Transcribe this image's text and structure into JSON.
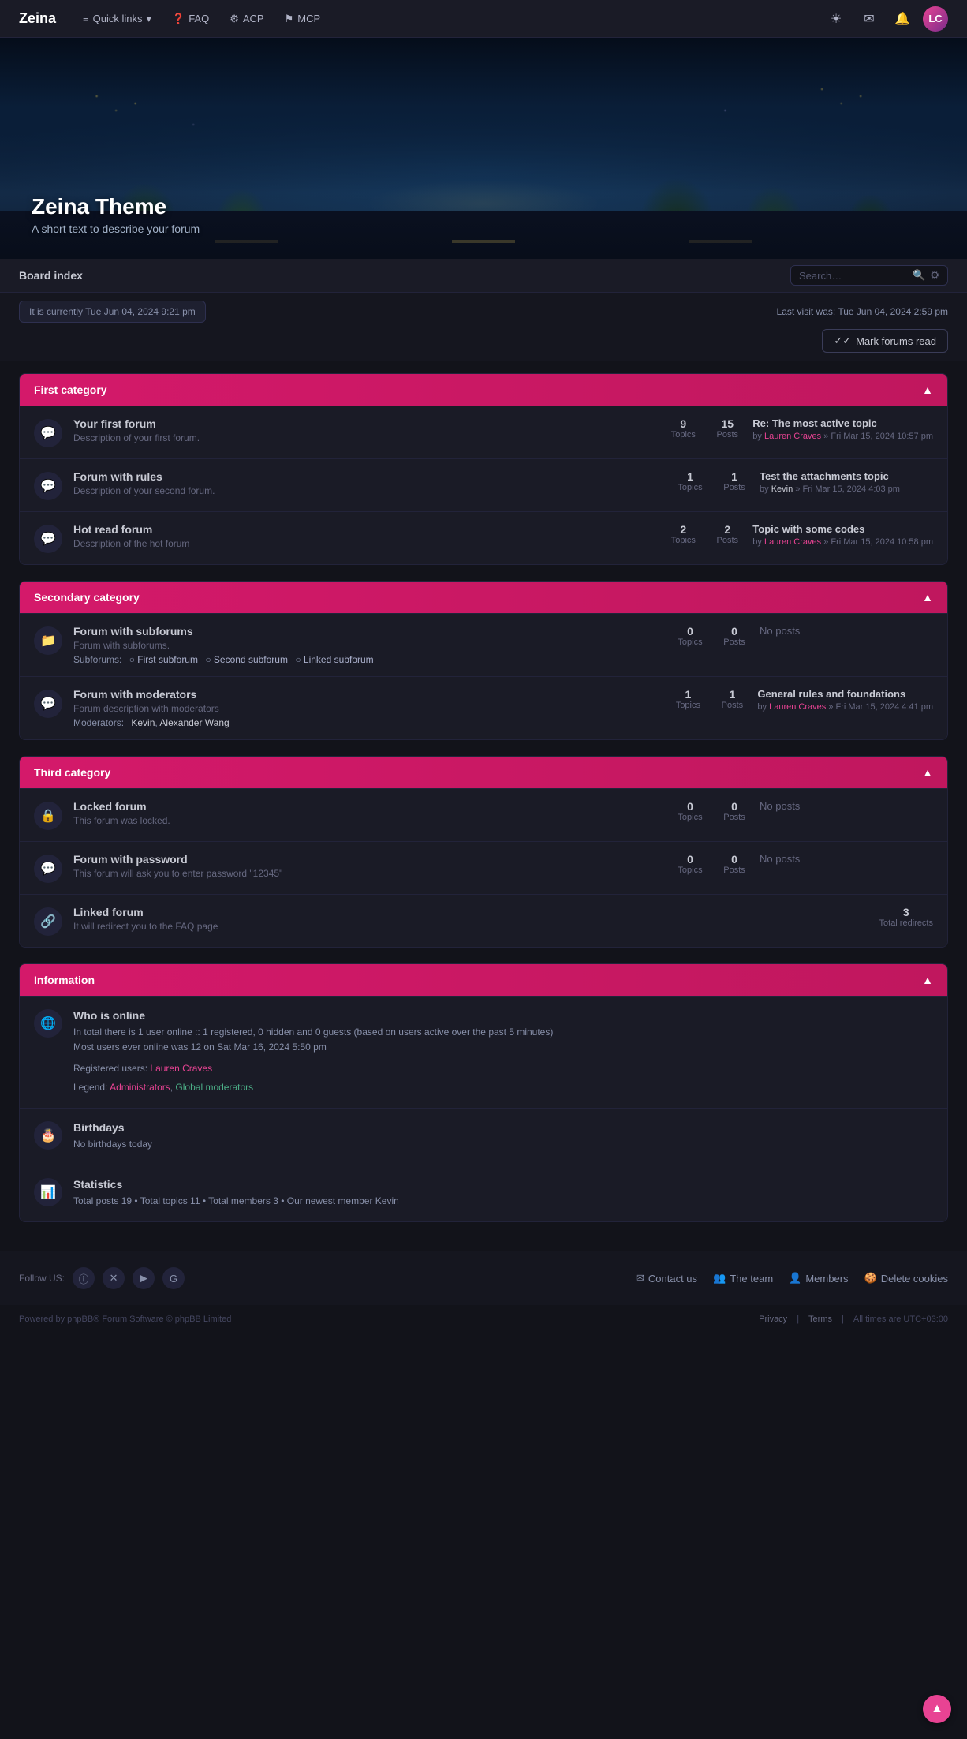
{
  "navbar": {
    "brand": "Zeina",
    "links": [
      {
        "label": "Quick links",
        "icon": "≡",
        "has_arrow": true
      },
      {
        "label": "FAQ",
        "icon": "?"
      },
      {
        "label": "ACP",
        "icon": "⚙"
      },
      {
        "label": "MCP",
        "icon": "⚑"
      }
    ],
    "icons": [
      "☀",
      "✉",
      "🔔"
    ],
    "avatar_initials": "LC"
  },
  "hero": {
    "title": "Zeina Theme",
    "subtitle": "A short text to describe your forum"
  },
  "breadcrumb_bar": {
    "breadcrumb": "Board index",
    "search_placeholder": "Search…"
  },
  "info_bar": {
    "current_time": "It is currently Tue Jun 04, 2024 9:21 pm",
    "last_visit": "Last visit was: Tue Jun 04, 2024 2:59 pm",
    "mark_read_label": "Mark forums read"
  },
  "categories": [
    {
      "id": "first",
      "title": "First category",
      "forums": [
        {
          "name": "Your first forum",
          "desc": "Description of your first forum.",
          "topics": "9",
          "posts": "15",
          "last_post_title": "Re: The most active topic",
          "last_post_by": "Lauren Craves",
          "last_post_date": "» Fri Mar 15, 2024 10:57 pm",
          "icon_type": "chat",
          "subforums": null,
          "moderators": null
        },
        {
          "name": "Forum with rules",
          "desc": "Description of your second forum.",
          "topics": "1",
          "posts": "1",
          "last_post_title": "Test the attachments topic",
          "last_post_by": "Kevin",
          "last_post_date": "» Fri Mar 15, 2024 4:03 pm",
          "icon_type": "chat",
          "subforums": null,
          "moderators": null
        },
        {
          "name": "Hot read forum",
          "desc": "Description of the hot forum",
          "topics": "2",
          "posts": "2",
          "last_post_title": "Topic with some codes",
          "last_post_by": "Lauren Craves",
          "last_post_date": "» Fri Mar 15, 2024 10:58 pm",
          "icon_type": "chat",
          "subforums": null,
          "moderators": null
        }
      ]
    },
    {
      "id": "second",
      "title": "Secondary category",
      "forums": [
        {
          "name": "Forum with subforums",
          "desc": "Forum with subforums.",
          "topics": "0",
          "posts": "0",
          "last_post_title": null,
          "last_post_by": null,
          "last_post_date": null,
          "icon_type": "folder",
          "subforums": [
            "First subforum",
            "Second subforum",
            "Linked subforum"
          ],
          "moderators": null
        },
        {
          "name": "Forum with moderators",
          "desc": "Forum description with moderators",
          "topics": "1",
          "posts": "1",
          "last_post_title": "General rules and foundations",
          "last_post_by": "Lauren Craves",
          "last_post_date": "» Fri Mar 15, 2024 4:41 pm",
          "icon_type": "chat",
          "subforums": null,
          "moderators": [
            "Kevin",
            "Alexander Wang"
          ]
        }
      ]
    },
    {
      "id": "third",
      "title": "Third category",
      "forums": [
        {
          "name": "Locked forum",
          "desc": "This forum was locked.",
          "topics": "0",
          "posts": "0",
          "last_post_title": null,
          "last_post_by": null,
          "last_post_date": null,
          "icon_type": "lock",
          "subforums": null,
          "moderators": null
        },
        {
          "name": "Forum with password",
          "desc": "This forum will ask you to enter password \"12345\"",
          "topics": "0",
          "posts": "0",
          "last_post_title": null,
          "last_post_by": null,
          "last_post_date": null,
          "icon_type": "chat",
          "subforums": null,
          "moderators": null
        },
        {
          "name": "Linked forum",
          "desc": "It will redirect you to the FAQ page",
          "topics": null,
          "posts": null,
          "redirects": "3",
          "last_post_title": null,
          "last_post_by": null,
          "last_post_date": null,
          "icon_type": "link",
          "subforums": null,
          "moderators": null
        }
      ]
    }
  ],
  "information": {
    "title": "Information",
    "rows": [
      {
        "id": "who_online",
        "title": "Who is online",
        "icon": "globe",
        "text_line1": "In total there is 1 user online :: 1 registered, 0 hidden and 0 guests (based on users active over the past 5 minutes)",
        "text_line2": "Most users ever online was 12 on Sat Mar 16, 2024 5:50 pm",
        "registered_users_label": "Registered users:",
        "registered_user": "Lauren Craves",
        "legend_label": "Legend:",
        "legend_admin": "Administrators",
        "legend_mod": "Global moderators"
      },
      {
        "id": "birthdays",
        "title": "Birthdays",
        "icon": "cake",
        "text": "No birthdays today"
      },
      {
        "id": "statistics",
        "title": "Statistics",
        "icon": "chart",
        "text": "Total posts 19  •  Total topics 11  •  Total members 3  •  Our newest member Kevin"
      }
    ]
  },
  "footer": {
    "follow_us_label": "Follow US:",
    "social_icons": [
      "ℹ",
      "𝕏",
      "▶",
      "G"
    ],
    "nav_links": [
      {
        "label": "Contact us",
        "icon": "📧"
      },
      {
        "label": "The team",
        "icon": "👥"
      },
      {
        "label": "Members",
        "icon": "👤"
      },
      {
        "label": "Delete cookies",
        "icon": "🍪"
      }
    ],
    "copyright": "Powered by phpBB® Forum Software © phpBB Limited",
    "bottom_links": [
      "Privacy",
      "Terms"
    ],
    "timezone": "All times are UTC+03:00"
  },
  "labels": {
    "topics": "Topics",
    "posts": "Posts",
    "no_posts": "No posts",
    "by": "by",
    "subforums": "Subforums:",
    "moderators": "Moderators:",
    "total_redirects": "Total redirects",
    "chevron_up": "▲"
  }
}
